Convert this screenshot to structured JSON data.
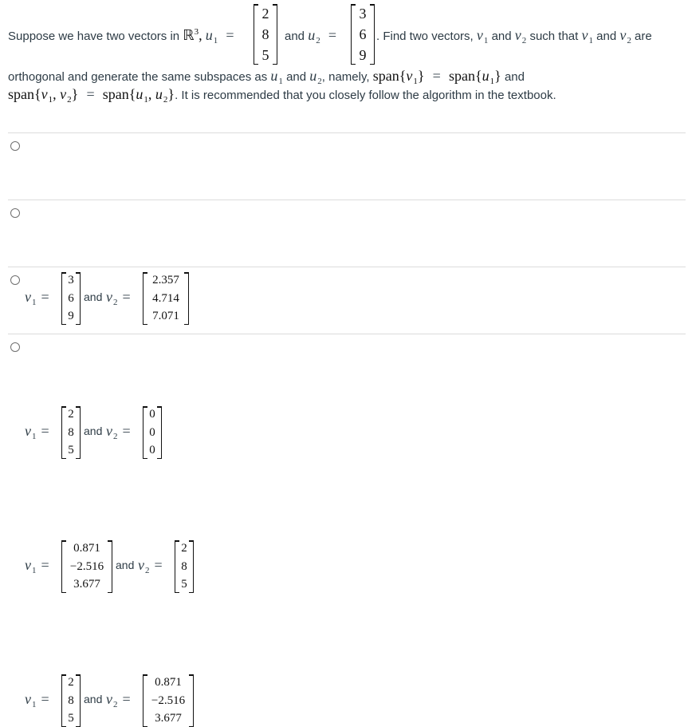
{
  "question": {
    "line1_prefix": "Suppose we have two vectors in",
    "space_symbol": "ℝ",
    "space_exponent": "3",
    "u1_label": "u",
    "u1_sub": "1",
    "u1_values": [
      "2",
      "8",
      "5"
    ],
    "and_text": "and",
    "u2_label": "u",
    "u2_sub": "2",
    "u2_values": [
      "3",
      "6",
      "9"
    ],
    "line1_suffix": ". Find two vectors,",
    "v1_label": "v",
    "v1_sub": "1",
    "v2_label": "v",
    "v2_sub": "2",
    "such_that": "such that",
    "are": "are",
    "line2_prefix": "orthogonal and generate the same subspaces as",
    "namely": ", namely,",
    "span_word": "span",
    "line3_suffix": ". It is recommended that you closely follow the algorithm in the textbook."
  },
  "options": [
    {
      "v1": [
        "3",
        "6",
        "9"
      ],
      "v2": [
        "2.357",
        "4.714",
        "7.071"
      ],
      "selected": false
    },
    {
      "v1": [
        "2",
        "8",
        "5"
      ],
      "v2": [
        "0",
        "0",
        "0"
      ],
      "selected": false
    },
    {
      "v1": [
        "0.871",
        "−2.516",
        "3.677"
      ],
      "v2": [
        "2",
        "8",
        "5"
      ],
      "selected": false
    },
    {
      "v1": [
        "2",
        "8",
        "5"
      ],
      "v2": [
        "0.871",
        "−2.516",
        "3.677"
      ],
      "selected": false
    }
  ],
  "labels": {
    "v1": "v",
    "v1_sub": "1",
    "v2": "v",
    "v2_sub": "2",
    "equals": "=",
    "and": "and"
  }
}
